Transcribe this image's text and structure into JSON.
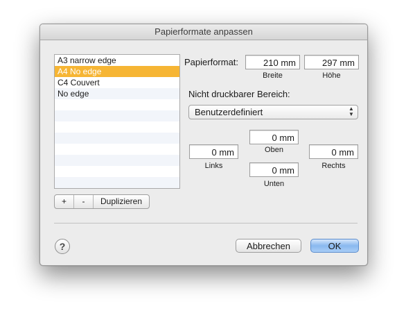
{
  "window": {
    "title": "Papierformate anpassen"
  },
  "formats": {
    "items": [
      {
        "label": "A3 narrow edge"
      },
      {
        "label": "A4 No edge"
      },
      {
        "label": "C4 Couvert"
      },
      {
        "label": "No edge"
      }
    ],
    "selected_index": 1
  },
  "list_buttons": {
    "add": "+",
    "remove": "-",
    "duplicate": "Duplizieren"
  },
  "paper": {
    "label": "Papierformat:",
    "width_value": "210 mm",
    "width_label": "Breite",
    "height_value": "297 mm",
    "height_label": "Höhe"
  },
  "margins": {
    "heading": "Nicht druckbarer Bereich:",
    "preset": "Benutzerdefiniert",
    "top_value": "0 mm",
    "top_label": "Oben",
    "left_value": "0 mm",
    "left_label": "Links",
    "right_value": "0 mm",
    "right_label": "Rechts",
    "bottom_value": "0 mm",
    "bottom_label": "Unten"
  },
  "footer": {
    "help": "?",
    "cancel": "Abbrechen",
    "ok": "OK"
  },
  "colors": {
    "selection": "#f6b534",
    "default_button": "#8ab9ef"
  }
}
